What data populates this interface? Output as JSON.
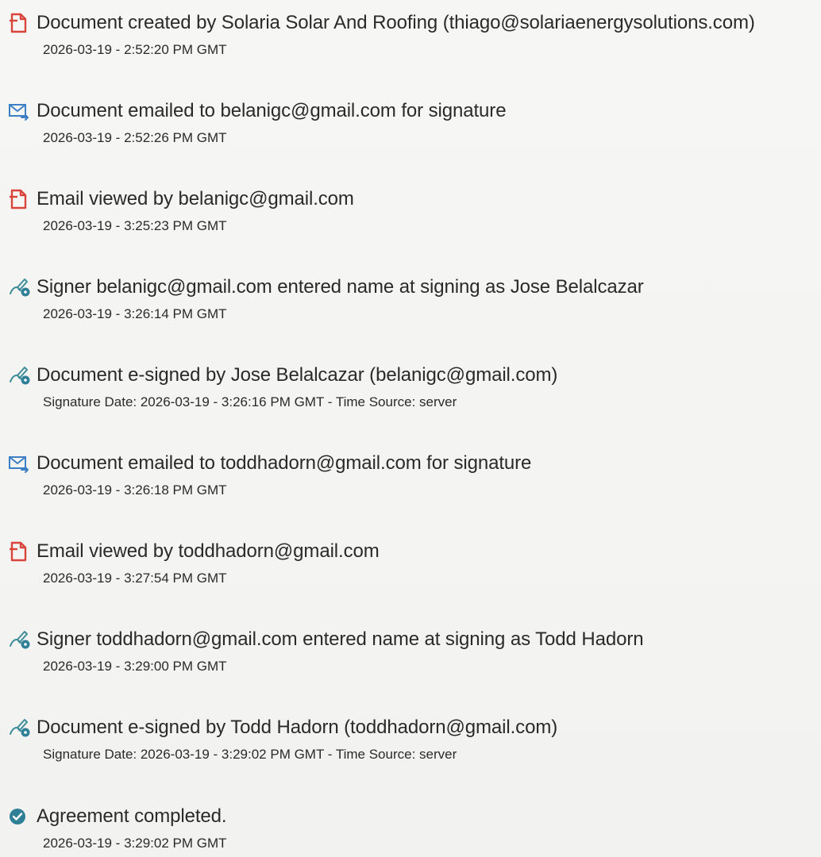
{
  "events": [
    {
      "title": "Document created by Solaria Solar And Roofing (thiago@solariaenergysolutions.com)",
      "detail": "2026-03-19 - 2:52:20 PM GMT",
      "icon": "document-icon"
    },
    {
      "title": "Document emailed to belanigc@gmail.com for signature",
      "detail": "2026-03-19 - 2:52:26 PM GMT",
      "icon": "email-send-icon"
    },
    {
      "title": "Email viewed by belanigc@gmail.com",
      "detail": "2026-03-19 - 3:25:23 PM GMT",
      "icon": "document-icon"
    },
    {
      "title": "Signer belanigc@gmail.com entered name at signing as Jose Belalcazar",
      "detail": "2026-03-19 - 3:26:14 PM GMT",
      "icon": "pen-sign-icon"
    },
    {
      "title": "Document e-signed by Jose Belalcazar (belanigc@gmail.com)",
      "detail": "Signature Date: 2026-03-19 - 3:26:16 PM GMT - Time Source: server",
      "icon": "pen-sign-icon"
    },
    {
      "title": "Document emailed to toddhadorn@gmail.com for signature",
      "detail": "2026-03-19 - 3:26:18 PM GMT",
      "icon": "email-send-icon"
    },
    {
      "title": "Email viewed by toddhadorn@gmail.com",
      "detail": "2026-03-19 - 3:27:54 PM GMT",
      "icon": "document-icon"
    },
    {
      "title": "Signer toddhadorn@gmail.com entered name at signing as Todd Hadorn",
      "detail": "2026-03-19 - 3:29:00 PM GMT",
      "icon": "pen-sign-icon"
    },
    {
      "title": "Document e-signed by Todd Hadorn (toddhadorn@gmail.com)",
      "detail": "Signature Date: 2026-03-19 - 3:29:02 PM GMT - Time Source: server",
      "icon": "pen-sign-icon"
    },
    {
      "title": "Agreement completed.",
      "detail": "2026-03-19 - 3:29:02 PM GMT",
      "icon": "check-circle-icon"
    }
  ],
  "colors": {
    "document_icon": "#d9443b",
    "email_icon": "#3d7fc4",
    "sign_icon": "#3d8c9a",
    "check_icon": "#2f7f96"
  }
}
